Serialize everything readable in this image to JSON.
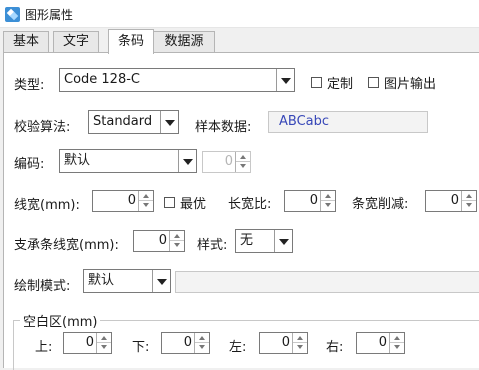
{
  "window": {
    "title": "图形属性"
  },
  "tabs": [
    {
      "label": "基本"
    },
    {
      "label": "文字"
    },
    {
      "label": "条码"
    },
    {
      "label": "数据源"
    }
  ],
  "active_tab": "条码",
  "barcode": {
    "type_label": "类型:",
    "type_value": "Code 128-C",
    "custom_label": "定制",
    "custom_checked": false,
    "image_output_label": "图片输出",
    "image_output_checked": false,
    "checksum_label": "校验算法:",
    "checksum_value": "Standard",
    "sample_label": "样本数据:",
    "sample_value": "ABCabc",
    "encoding_label": "编码:",
    "encoding_value": "默认",
    "encoding_number": "0",
    "line_width_label": "线宽(mm):",
    "line_width_value": "0",
    "optimal_label": "最优",
    "optimal_checked": false,
    "aspect_label": "长宽比:",
    "aspect_value": "0",
    "bar_reduce_label": "条宽削减:",
    "bar_reduce_value": "0",
    "bearer_label": "支承条线宽(mm):",
    "bearer_value": "0",
    "style_label": "样式:",
    "style_value": "无",
    "draw_mode_label": "绘制模式:",
    "draw_mode_value": "默认"
  },
  "quiet_zone": {
    "title": "空白区(mm)",
    "top_label": "上:",
    "top_value": "0",
    "bottom_label": "下:",
    "bottom_value": "0",
    "left_label": "左:",
    "left_value": "0",
    "right_label": "右:",
    "right_value": "0"
  },
  "colors": {
    "sample_text": "#3747b8",
    "app_icon": "#3c8fd6"
  }
}
